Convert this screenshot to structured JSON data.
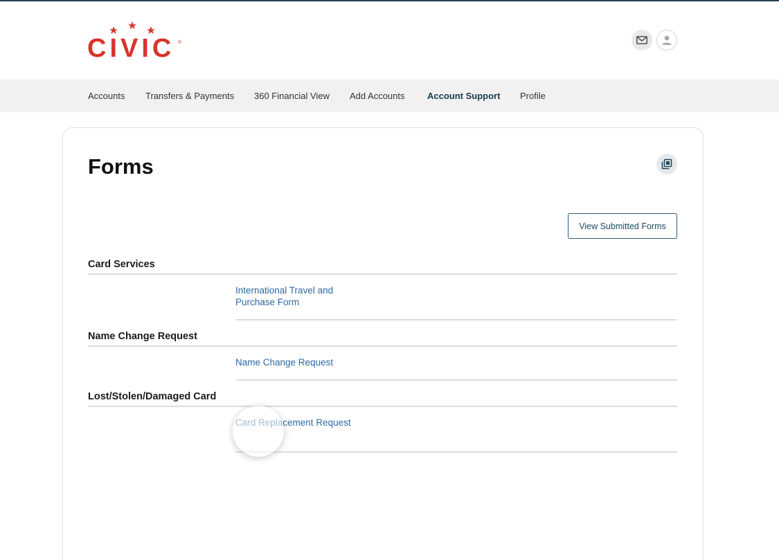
{
  "brand": {
    "logo_text": "CIVIC",
    "logo_mark": "®",
    "brand_color": "#d8342a"
  },
  "header": {
    "icons": [
      "mail-icon",
      "user-icon"
    ]
  },
  "nav": {
    "items": [
      {
        "label": "Accounts",
        "active": false
      },
      {
        "label": "Transfers & Payments",
        "active": false
      },
      {
        "label": "360 Financial View",
        "active": false
      },
      {
        "label": "Add Accounts",
        "active": false
      },
      {
        "label": "Account Support",
        "active": true
      },
      {
        "label": "Profile",
        "active": false
      }
    ]
  },
  "page": {
    "title": "Forms",
    "copy_icon": "copy-icon",
    "view_submitted_label": "View Submitted Forms"
  },
  "sections": [
    {
      "title": "Card Services",
      "forms": [
        "International Travel and Purchase Form"
      ]
    },
    {
      "title": "Name Change Request",
      "forms": [
        "Name Change Request"
      ]
    },
    {
      "title": "Lost/Stolen/Damaged Card",
      "forms": [
        "Card Replacement Request"
      ]
    }
  ],
  "colors": {
    "link": "#2f68a2",
    "button_border": "#2c5a74",
    "active_nav": "#173c52"
  }
}
